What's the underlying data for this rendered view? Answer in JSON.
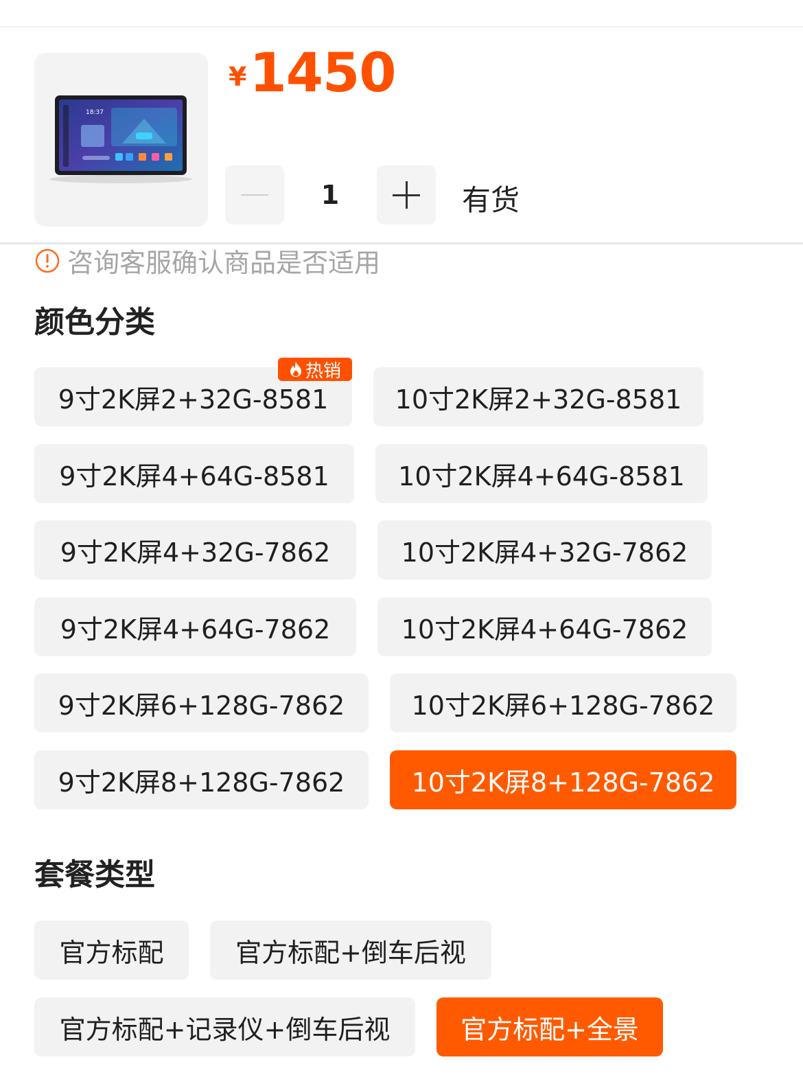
{
  "product": {
    "currency_symbol": "¥",
    "price": "1450"
  },
  "quantity": {
    "value": "1",
    "decrease_label": "—",
    "increase_label": "+"
  },
  "stock_status": "有货",
  "notice": "咨询客服确认商品是否适用",
  "color_section": {
    "title": "颜色分类",
    "hot_badge": "热销",
    "options": [
      "9寸2K屏2+32G-8581",
      "10寸2K屏2+32G-8581",
      "9寸2K屏4+64G-8581",
      "10寸2K屏4+64G-8581",
      "9寸2K屏4+32G-7862",
      "10寸2K屏4+32G-7862",
      "9寸2K屏4+64G-7862",
      "10寸2K屏4+64G-7862",
      "9寸2K屏6+128G-7862",
      "10寸2K屏6+128G-7862",
      "9寸2K屏8+128G-7862",
      "10寸2K屏8+128G-7862"
    ],
    "selected": "10寸2K屏8+128G-7862"
  },
  "package_section": {
    "title": "套餐类型",
    "options": [
      "官方标配",
      "官方标配+倒车后视",
      "官方标配+记录仪+倒车后视",
      "官方标配+全景"
    ],
    "selected": "官方标配+全景"
  },
  "colors": {
    "accent": "#ff5000",
    "chip_bg": "#f2f2f2"
  }
}
